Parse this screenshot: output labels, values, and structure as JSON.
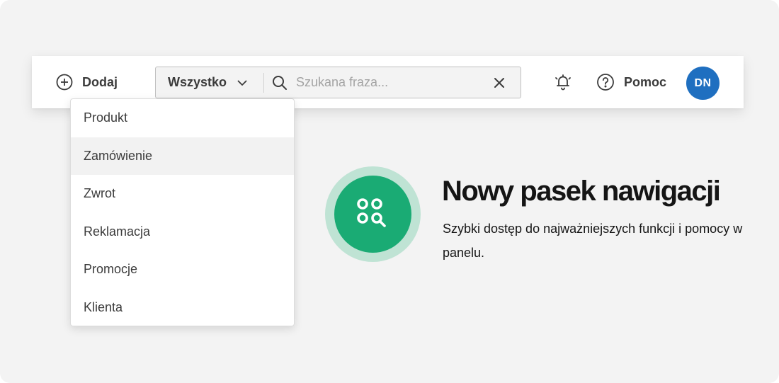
{
  "navbar": {
    "add_label": "Dodaj",
    "search": {
      "scope_label": "Wszystko",
      "placeholder": "Szukana fraza...",
      "value": ""
    },
    "help_label": "Pomoc",
    "avatar_initials": "DN"
  },
  "dropdown": {
    "items": [
      {
        "label": "Produkt"
      },
      {
        "label": "Zamówienie"
      },
      {
        "label": "Zwrot"
      },
      {
        "label": "Reklamacja"
      },
      {
        "label": "Promocje"
      },
      {
        "label": "Klienta"
      }
    ],
    "hovered_index": 1
  },
  "promo": {
    "title": "Nowy pasek nawigacji",
    "description": "Szybki dostęp do najważniejszych funkcji i pomocy w panelu."
  },
  "colors": {
    "accent_green": "#1aab74",
    "accent_green_light": "#bfe3d4",
    "avatar_blue": "#1f6fc0",
    "text_dark": "#3b3b3b"
  },
  "icons": {
    "add": "plus-circle-icon",
    "scope_toggle": "chevron-down-icon",
    "search": "search-icon",
    "clear": "close-icon",
    "notifications": "bell-icon",
    "help": "question-circle-icon",
    "promo": "apps-search-icon"
  }
}
